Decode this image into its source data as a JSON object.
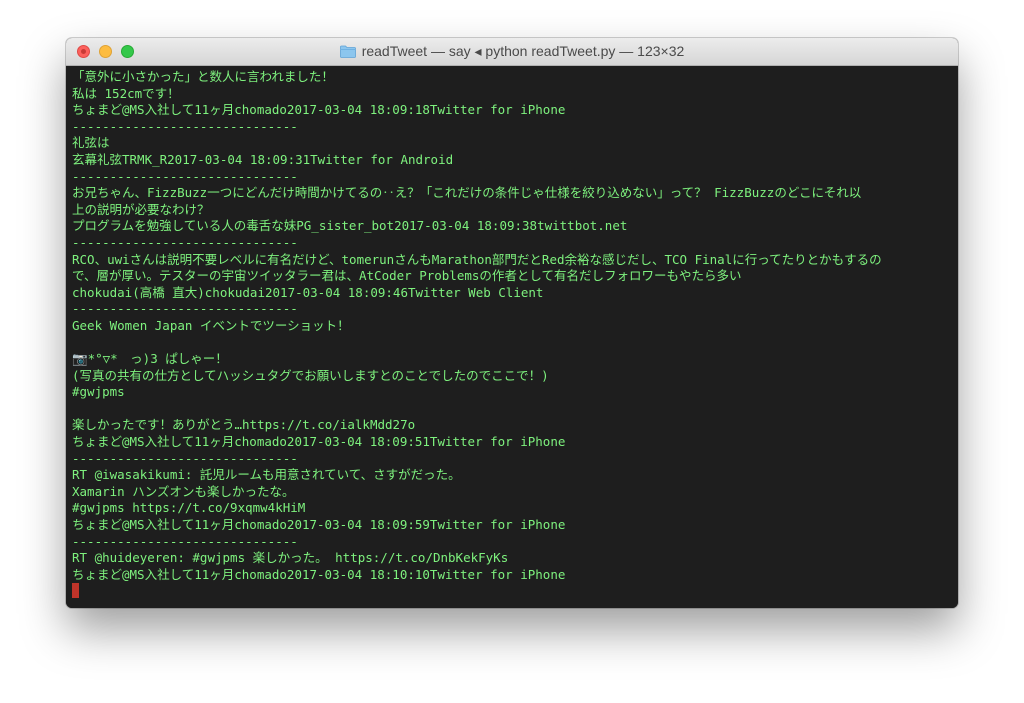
{
  "window": {
    "title": "readTweet — say ◂ python readTweet.py — 123×32"
  },
  "terminal": {
    "lines": [
      "「意外に小さかった」と数人に言われました！",
      "私は 152cmです！",
      "ちょまど@MS入社して11ヶ月chomado2017-03-04 18:09:18Twitter for iPhone",
      "------------------------------",
      "礼弦は",
      "玄幕礼弦TRMK_R2017-03-04 18:09:31Twitter for Android",
      "------------------------------",
      "お兄ちゃん、FizzBuzz一つにどんだけ時間かけてるの‥え？「これだけの条件じゃ仕様を絞り込めない」って？ FizzBuzzのどこにそれ以",
      "上の説明が必要なわけ？",
      "プログラムを勉強している人の毒舌な妹PG_sister_bot2017-03-04 18:09:38twittbot.net",
      "------------------------------",
      "RCO、uwiさんは説明不要レベルに有名だけど、tomerunさんもMarathon部門だとRed余裕な感じだし、TCO Finalに行ってたりとかもするの",
      "で、層が厚い。テスターの宇宙ツイッタラー君は、AtCoder Problemsの作者として有名だしフォロワーもやたら多い",
      "chokudai(高橋 直大)chokudai2017-03-04 18:09:46Twitter Web Client",
      "------------------------------",
      "Geek Women Japan イベントでツーショット！",
      "",
      "📷*°▽*　っ)3 ぱしゃー！",
      "(写真の共有の仕方としてハッシュタグでお願いしますとのことでしたのでここで！)",
      "#gwjpms",
      "",
      "楽しかったです！ありがとう…https://t.co/ialkMdd27o",
      "ちょまど@MS入社して11ヶ月chomado2017-03-04 18:09:51Twitter for iPhone",
      "------------------------------",
      "RT @iwasakikumi: 託児ルームも用意されていて、さすがだった。",
      "Xamarin ハンズオンも楽しかったな。",
      "#gwjpms https://t.co/9xqmw4kHiM",
      "ちょまど@MS入社して11ヶ月chomado2017-03-04 18:09:59Twitter for iPhone",
      "------------------------------",
      "RT @huideyeren: #gwjpms 楽しかった。 https://t.co/DnbKekFyKs",
      "ちょまど@MS入社して11ヶ月chomado2017-03-04 18:10:10Twitter for iPhone"
    ]
  },
  "colors": {
    "terminal_bg": "#1e1e1e",
    "terminal_text": "#7ef27e",
    "cursor": "#c0342a",
    "close": "#fc605c",
    "minimize": "#fdbc40",
    "maximize": "#34c84a"
  },
  "icons": {
    "title": "folder-icon"
  }
}
